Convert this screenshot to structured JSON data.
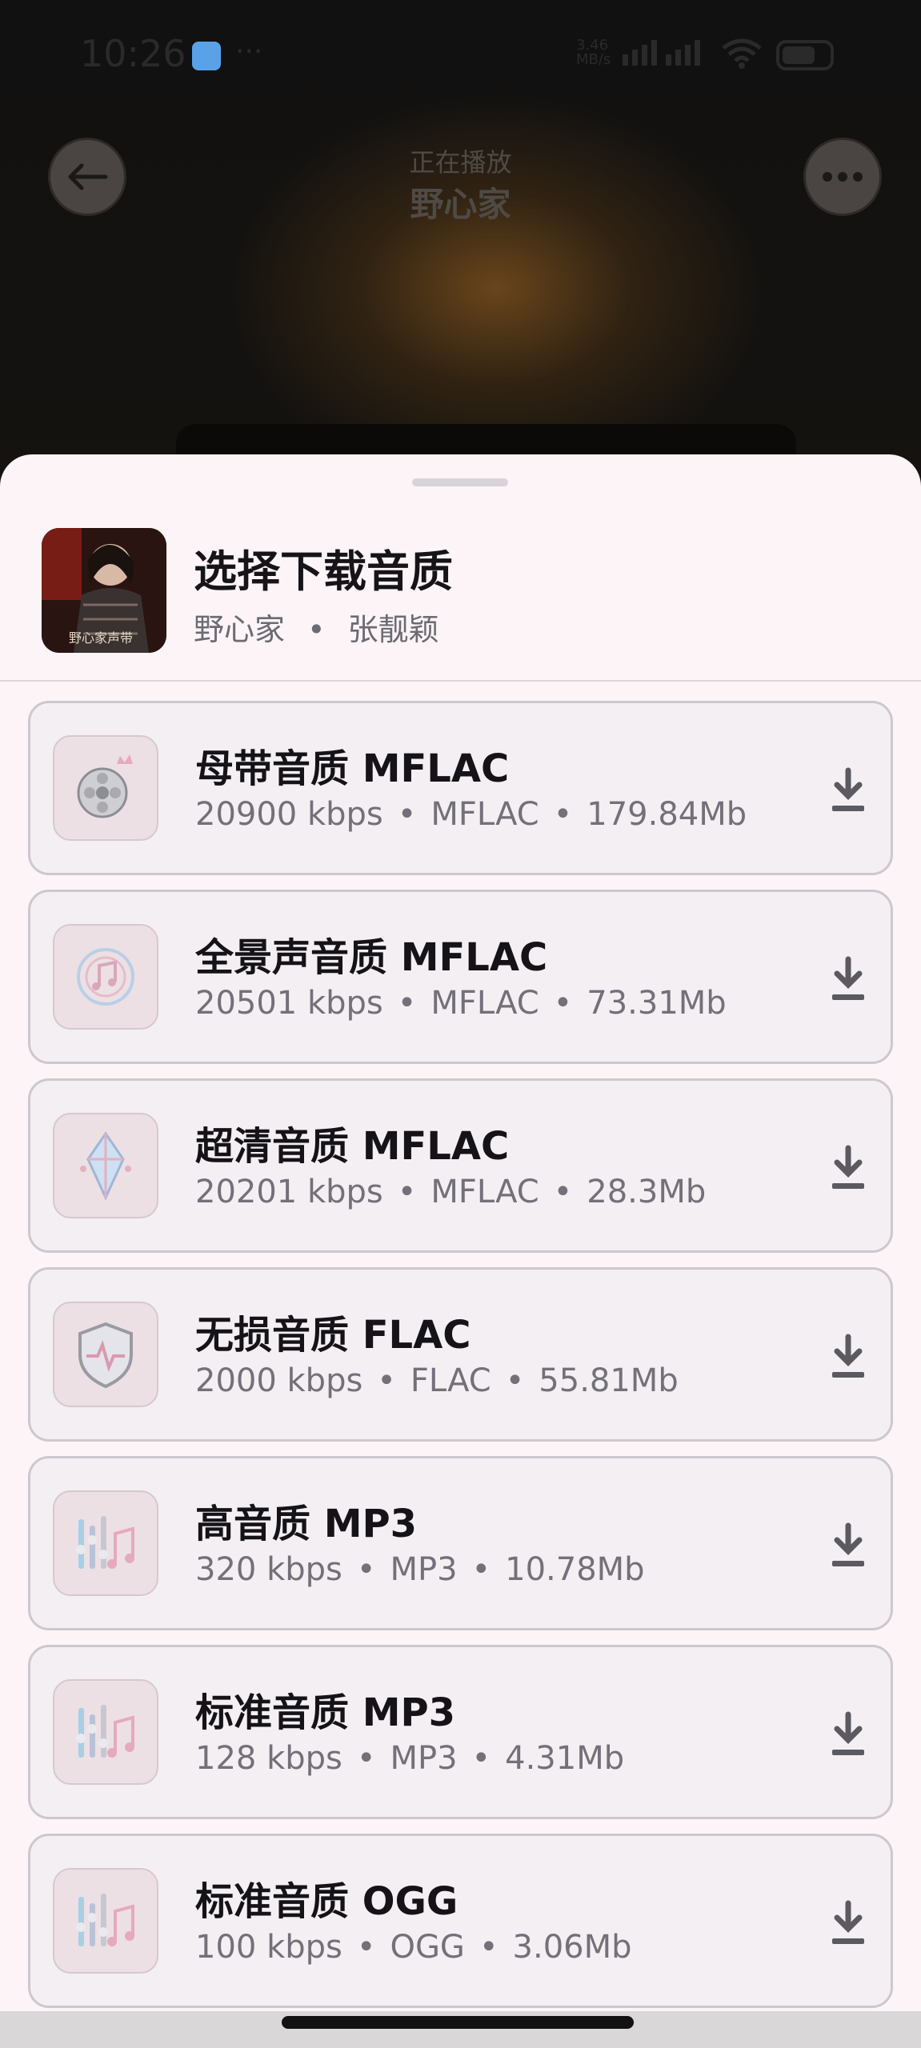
{
  "status_bar": {
    "time": "10:26",
    "dots": "···",
    "net_speed_value": "3.46",
    "net_speed_unit": "MB/s"
  },
  "player": {
    "now_playing_label": "正在播放",
    "song_title": "野心家",
    "back_icon": "arrow-left-icon",
    "more_icon": "more-horizontal-icon"
  },
  "sheet": {
    "title": "选择下载音质",
    "song": "野心家",
    "separator": "•",
    "artist": "张靓颖",
    "album_art_label": "野心家声带"
  },
  "qualities": [
    {
      "name": "母带音质 MFLAC",
      "bitrate": "20900 kbps",
      "format": "MFLAC",
      "size": "179.84Mb",
      "icon": "master-reel-icon"
    },
    {
      "name": "全景声音质 MFLAC",
      "bitrate": "20501 kbps",
      "format": "MFLAC",
      "size": "73.31Mb",
      "icon": "surround-music-icon"
    },
    {
      "name": "超清音质 MFLAC",
      "bitrate": "20201 kbps",
      "format": "MFLAC",
      "size": "28.3Mb",
      "icon": "crystal-icon"
    },
    {
      "name": "无损音质 FLAC",
      "bitrate": "2000 kbps",
      "format": "FLAC",
      "size": "55.81Mb",
      "icon": "lossless-shield-icon"
    },
    {
      "name": "高音质 MP3",
      "bitrate": "320 kbps",
      "format": "MP3",
      "size": "10.78Mb",
      "icon": "equalizer-note-icon"
    },
    {
      "name": "标准音质 MP3",
      "bitrate": "128 kbps",
      "format": "MP3",
      "size": "4.31Mb",
      "icon": "equalizer-note-icon"
    },
    {
      "name": "标准音质 OGG",
      "bitrate": "100 kbps",
      "format": "OGG",
      "size": "3.06Mb",
      "icon": "equalizer-note-icon"
    }
  ],
  "colors": {
    "sheet_bg": "#fcf4f6",
    "item_bg": "#f3eff3",
    "title_text": "#151317",
    "meta_text": "#737079"
  }
}
